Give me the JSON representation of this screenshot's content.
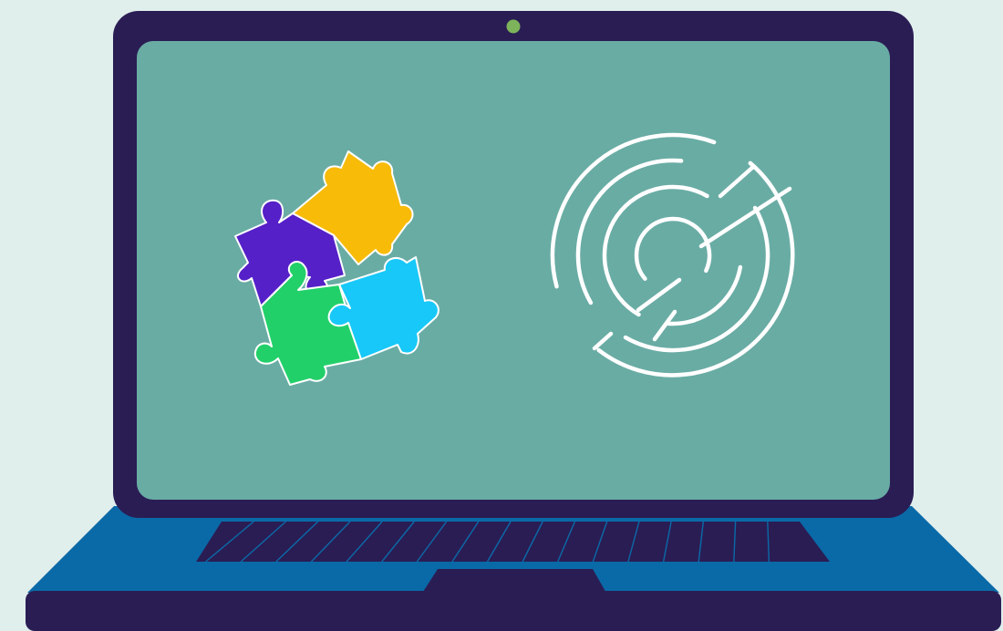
{
  "illustration": {
    "subject": "laptop",
    "screen_icons": [
      "puzzle-pieces-icon",
      "maze-icon"
    ],
    "colors": {
      "background": "#e0eeec",
      "laptop_frame": "#2a1d54",
      "screen": "#69aca4",
      "webcam": "#7db35a",
      "keyboard_deck": "#0a6aa8",
      "keys": "#2a1d54",
      "puzzle_purple": "#5520c8",
      "puzzle_yellow": "#f8bb08",
      "puzzle_green": "#22d06a",
      "puzzle_cyan": "#18c8f8",
      "maze_stroke": "#ffffff"
    }
  }
}
